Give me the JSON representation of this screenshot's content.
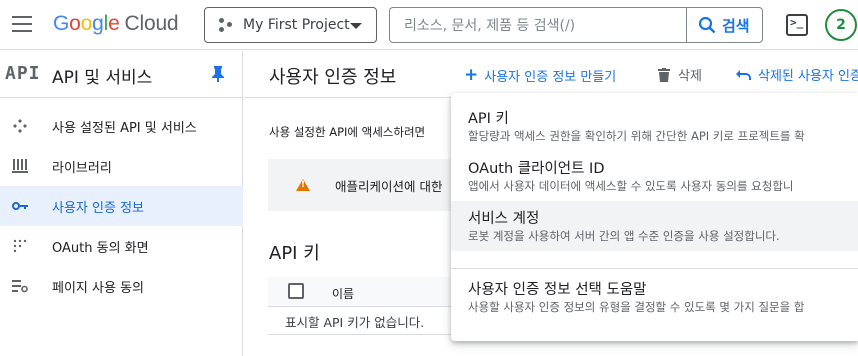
{
  "topbar": {
    "logo_google": "Google",
    "logo_cloud": "Cloud",
    "project_name": "My First Project",
    "search_placeholder": "리소스, 문서, 제품 등 검색(/)",
    "search_button": "검색",
    "avatar_letter": "2"
  },
  "sidebar": {
    "api_logo": "API",
    "title": "API 및 서비스",
    "items": [
      {
        "label": "사용 설정된 API 및 서비스",
        "icon": "api-diamond-icon"
      },
      {
        "label": "라이브러리",
        "icon": "library-icon"
      },
      {
        "label": "사용자 인증 정보",
        "icon": "key-icon",
        "active": true
      },
      {
        "label": "OAuth 동의 화면",
        "icon": "consent-dots-icon"
      },
      {
        "label": "페이지 사용 동의",
        "icon": "settings-list-icon"
      }
    ]
  },
  "main": {
    "page_title": "사용자 인증 정보",
    "actions": {
      "create": "사용자 인증 정보 만들기",
      "delete": "삭제",
      "restore": "삭제된 사용자 인증"
    },
    "description": "사용 설정한 API에 액세스하려면",
    "warning": "애플리케이션에 대한",
    "section_title": "API 키",
    "table": {
      "column_name": "이름",
      "empty_text": "표시할 API 키가 없습니다."
    }
  },
  "dropdown": {
    "items": [
      {
        "title": "API 키",
        "description": "할당량과 액세스 권한을 확인하기 위해 간단한 API 키로 프로젝트를 확"
      },
      {
        "title": "OAuth 클라이언트 ID",
        "description": "앱에서 사용자 데이터에 액세스할 수 있도록 사용자 동의를 요청합니"
      },
      {
        "title": "서비스 계정",
        "description": "로봇 계정을 사용하여 서버 간의 앱 수준 인증을 사용 설정합니다."
      },
      {
        "title": "사용자 인증 정보 선택 도움말",
        "description": "사용할 사용자 인증 정보의 유형을 결정할 수 있도록 몇 가지 질문을 합"
      }
    ]
  },
  "colors": {
    "accent": "#1a73e8",
    "active_bg": "#e8f0fe",
    "warning": "#e37400",
    "avatar_ring": "#1e8e3e"
  }
}
